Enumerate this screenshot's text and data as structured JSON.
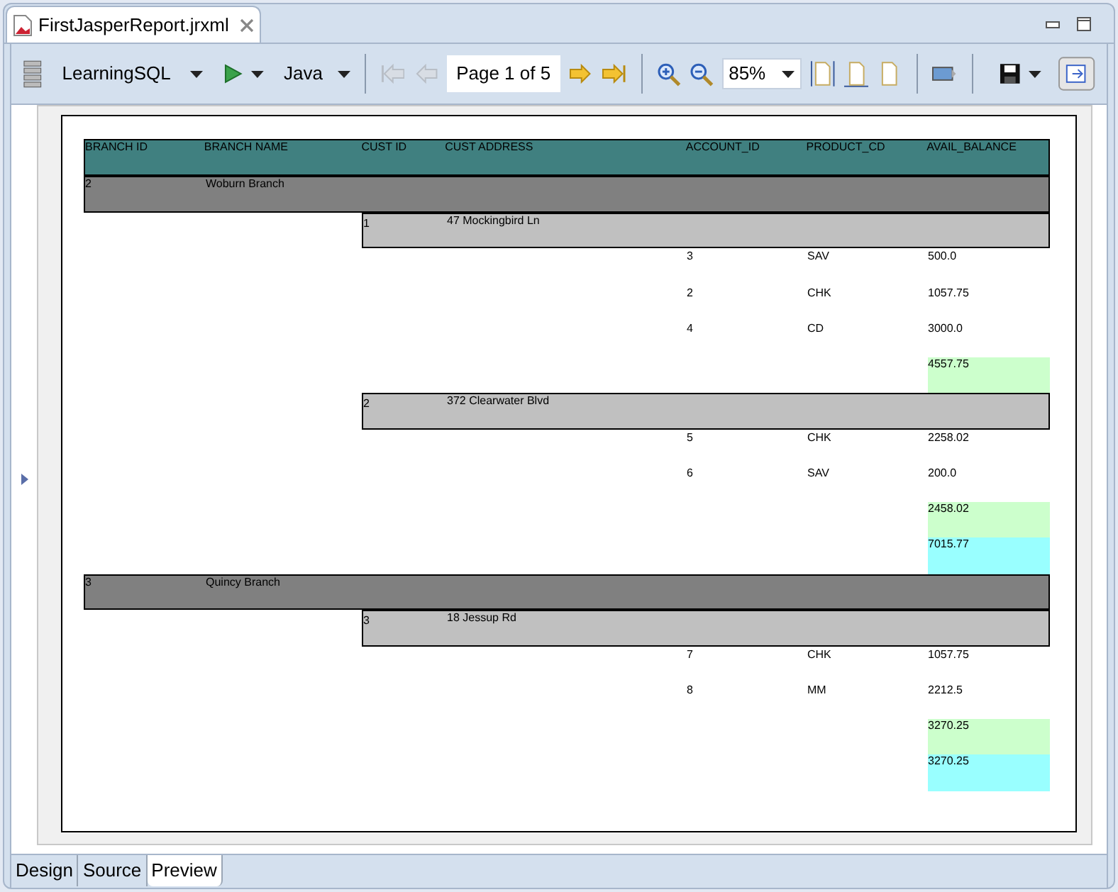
{
  "editor_tab": {
    "title": "FirstJasperReport.jrxml"
  },
  "toolbar": {
    "datasource": "LearningSQL",
    "language": "Java",
    "page_indicator": "Page 1 of 5",
    "zoom": "85%"
  },
  "report": {
    "columns": [
      "BRANCH ID",
      "BRANCH NAME",
      "CUST ID",
      "CUST ADDRESS",
      "ACCOUNT_ID",
      "PRODUCT_CD",
      "AVAIL_BALANCE"
    ],
    "rows": [
      {
        "kind": "branch",
        "cells": [
          "2",
          "Woburn Branch"
        ]
      },
      {
        "kind": "customer",
        "cells": [
          "1",
          "47 Mockingbird Ln"
        ]
      },
      {
        "kind": "account",
        "cells": [
          "3",
          "SAV",
          "500.0"
        ]
      },
      {
        "kind": "account",
        "cells": [
          "2",
          "CHK",
          "1057.75"
        ]
      },
      {
        "kind": "account",
        "cells": [
          "4",
          "CD",
          "3000.0"
        ]
      },
      {
        "kind": "customer_total",
        "cells": [
          "4557.75"
        ]
      },
      {
        "kind": "customer",
        "cells": [
          "2",
          "372 Clearwater Blvd"
        ]
      },
      {
        "kind": "account",
        "cells": [
          "5",
          "CHK",
          "2258.02"
        ]
      },
      {
        "kind": "account",
        "cells": [
          "6",
          "SAV",
          "200.0"
        ]
      },
      {
        "kind": "customer_total",
        "cells": [
          "2458.02"
        ]
      },
      {
        "kind": "branch_total",
        "cells": [
          "7015.77"
        ]
      },
      {
        "kind": "branch",
        "cells": [
          "3",
          "Quincy Branch"
        ]
      },
      {
        "kind": "customer",
        "cells": [
          "3",
          "18 Jessup Rd"
        ]
      },
      {
        "kind": "account",
        "cells": [
          "7",
          "CHK",
          "1057.75"
        ]
      },
      {
        "kind": "account",
        "cells": [
          "8",
          "MM",
          "2212.5"
        ]
      },
      {
        "kind": "customer_total",
        "cells": [
          "3270.25"
        ]
      },
      {
        "kind": "branch_total",
        "cells": [
          "3270.25"
        ]
      }
    ]
  },
  "bottom_tabs": [
    {
      "label": "Design",
      "selected": false
    },
    {
      "label": "Source",
      "selected": false
    },
    {
      "label": "Preview",
      "selected": true
    }
  ]
}
